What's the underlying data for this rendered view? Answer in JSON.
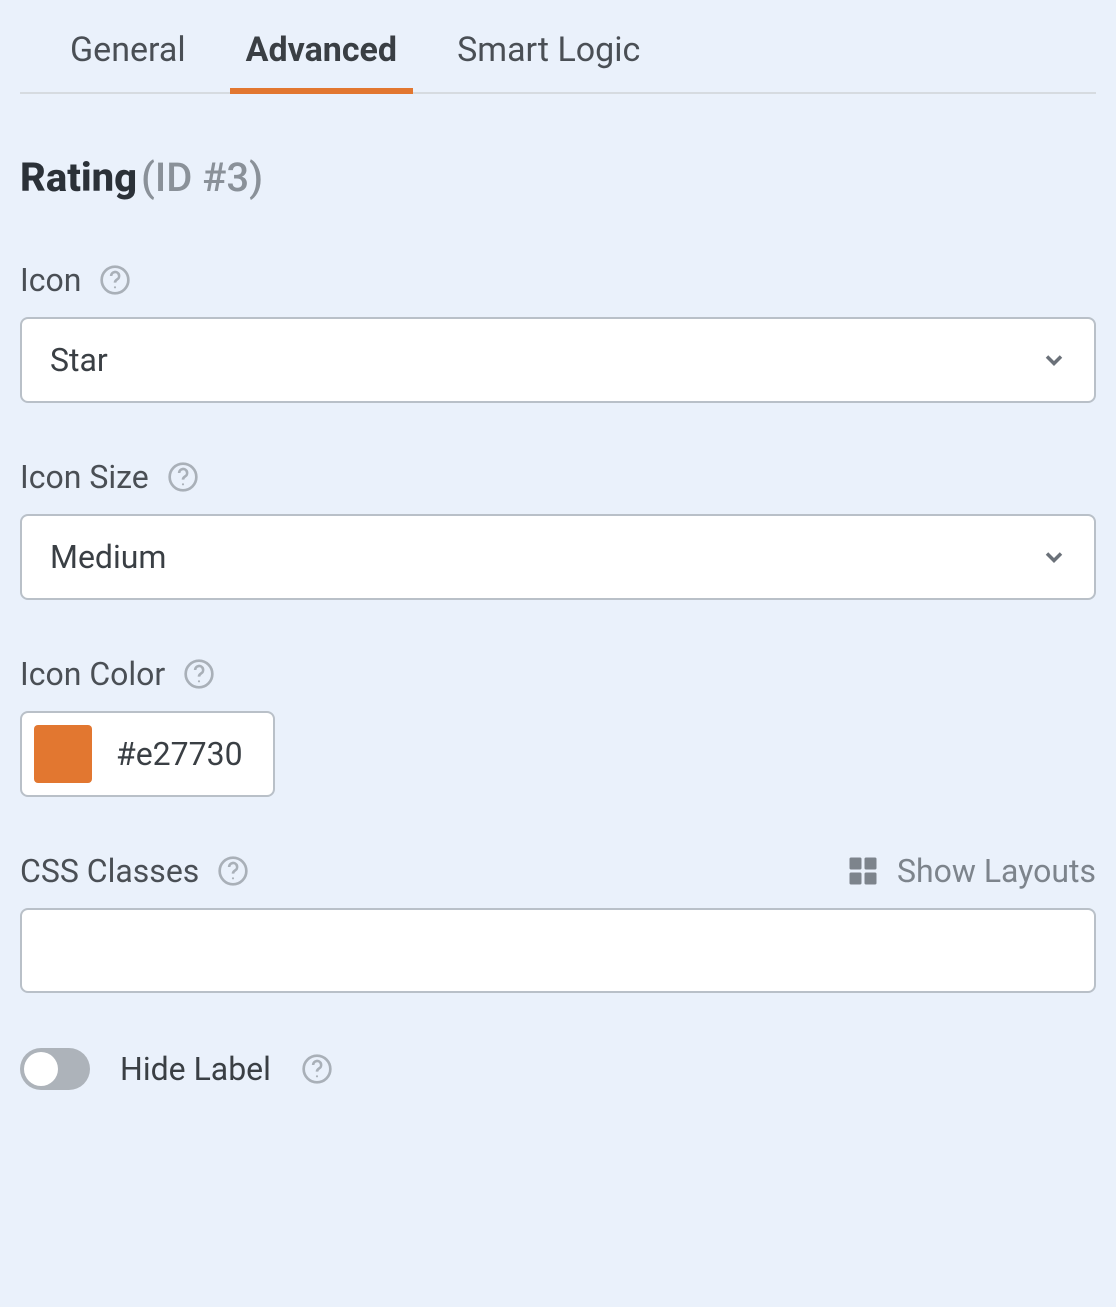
{
  "tabs": {
    "general": "General",
    "advanced": "Advanced",
    "smart_logic": "Smart Logic"
  },
  "title": {
    "name": "Rating",
    "id": "(ID #3)"
  },
  "fields": {
    "icon": {
      "label": "Icon",
      "value": "Star"
    },
    "icon_size": {
      "label": "Icon Size",
      "value": "Medium"
    },
    "icon_color": {
      "label": "Icon Color",
      "value": "#e27730",
      "swatch": "#e27730"
    },
    "css_classes": {
      "label": "CSS Classes",
      "value": "",
      "show_layouts": "Show Layouts"
    },
    "hide_label": {
      "label": "Hide Label",
      "on": false
    }
  }
}
